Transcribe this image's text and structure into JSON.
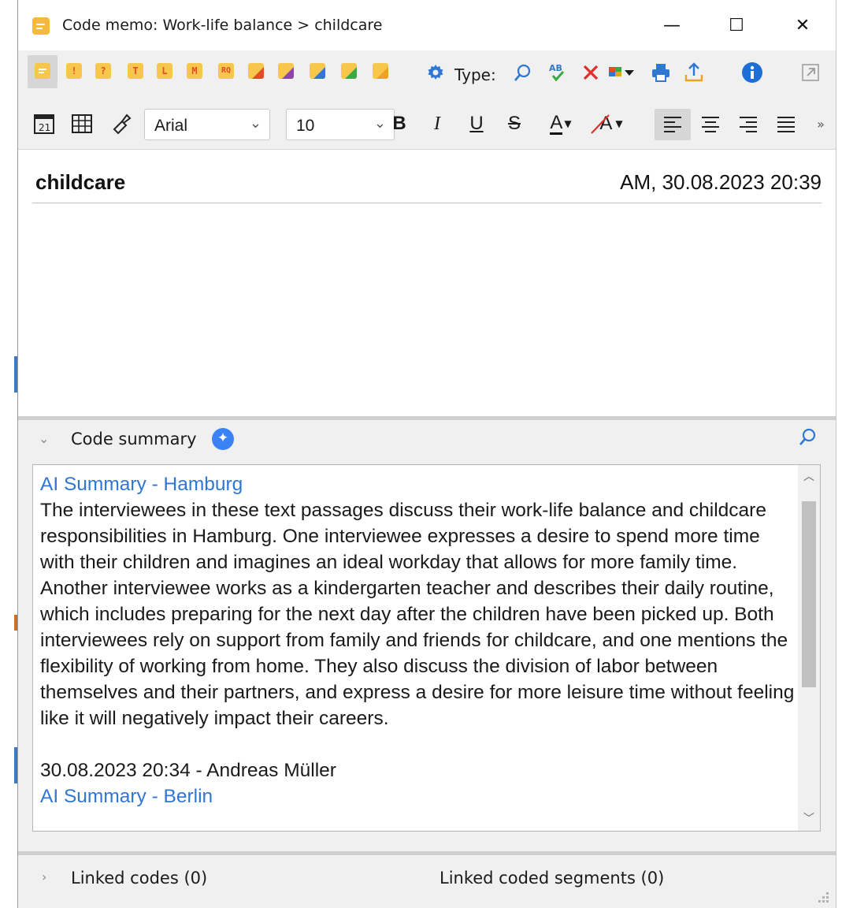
{
  "window": {
    "title": "Code memo: Work-life balance > childcare",
    "minimize": "—",
    "maximize": "☐",
    "close": "✕"
  },
  "toolbar1": {
    "memo_types": [
      {
        "name": "memo-type-default",
        "letter": "",
        "bg": "#f7c64d",
        "fg": "#ffffff"
      },
      {
        "name": "memo-type-important",
        "letter": "!",
        "bg": "#f7c64d",
        "fg": "#e34c26"
      },
      {
        "name": "memo-type-question",
        "letter": "?",
        "bg": "#f7c64d",
        "fg": "#e34c26"
      },
      {
        "name": "memo-type-theory",
        "letter": "T",
        "bg": "#f7c64d",
        "fg": "#e34c26"
      },
      {
        "name": "memo-type-literature",
        "letter": "L",
        "bg": "#f7c64d",
        "fg": "#e34c26"
      },
      {
        "name": "memo-type-method",
        "letter": "M",
        "bg": "#f7c64d",
        "fg": "#e34c26"
      },
      {
        "name": "memo-type-research-question",
        "letter": "RQ",
        "bg": "#f7c64d",
        "fg": "#e34c26"
      }
    ],
    "color_memos": [
      "#e34c26",
      "#8e44ad",
      "#2f77d0",
      "#3aa845",
      "#f0a020"
    ],
    "type_label": "Type:",
    "icons": [
      "settings-gear-icon",
      "search-icon",
      "spellcheck-icon",
      "delete-icon",
      "color-picker-icon",
      "print-icon",
      "export-icon",
      "info-icon",
      "undock-icon"
    ]
  },
  "toolbar2": {
    "font_family": "Arial",
    "font_size": "10",
    "bold": "B",
    "italic": "I",
    "underline": "U",
    "strike": "S",
    "font_color": "A",
    "highlight": "A",
    "overflow": "»"
  },
  "memo": {
    "title": "childcare",
    "meta": "AM, 30.08.2023 20:39"
  },
  "summary": {
    "label": "Code summary",
    "entries": [
      {
        "heading": "AI Summary - Hamburg",
        "text": "The interviewees in these text passages discuss their work-life balance and childcare responsibilities in Hamburg. One interviewee expresses a desire to spend more time with their children and imagines an ideal workday that allows for more family time. Another interviewee works as a kindergarten teacher and describes their daily routine, which includes preparing for the next day after the children have been picked up. Both interviewees rely on support from family and friends for childcare, and one mentions the flexibility of working from home. They also discuss the division of labor between themselves and their partners, and express a desire for more leisure time without feeling like it will negatively impact their careers."
      }
    ],
    "footer_line": "30.08.2023 20:34 - Andreas Müller",
    "next_heading": "AI Summary - Berlin"
  },
  "linked": {
    "codes": "Linked codes (0)",
    "segments": "Linked coded segments (0)"
  }
}
